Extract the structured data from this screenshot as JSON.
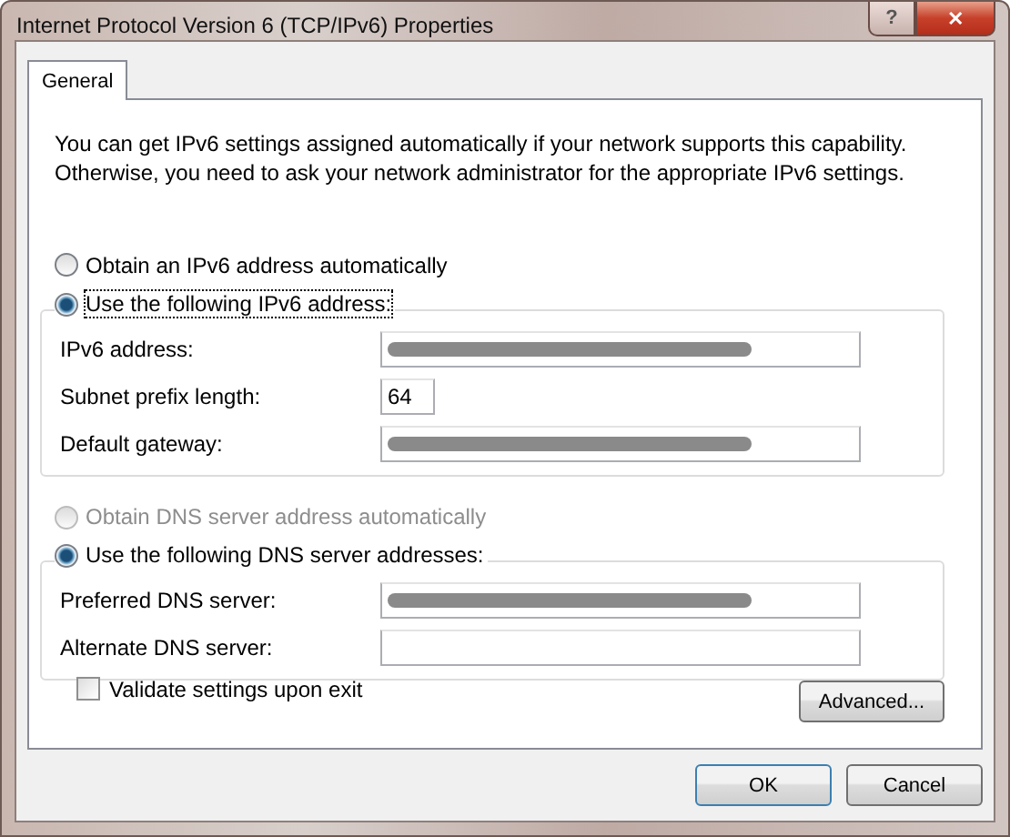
{
  "window": {
    "title": "Internet Protocol Version 6 (TCP/IPv6) Properties",
    "controls": [
      "?",
      "✕"
    ]
  },
  "tabs": [
    {
      "label": "General",
      "selected": true
    }
  ],
  "intro": "You can get IPv6 settings assigned automatically if your network supports this capability. Otherwise, you need to ask your network administrator for the appropriate IPv6 settings.",
  "address_options": [
    {
      "label": "Obtain an IPv6 address automatically",
      "selected": false,
      "disabled": false
    },
    {
      "label": "Use the following IPv6 address:",
      "selected": true,
      "disabled": false
    }
  ],
  "address_fields": [
    {
      "label": "IPv6 address:",
      "redacted": true,
      "kind": "address"
    },
    {
      "label": "Subnet prefix length:",
      "value": "64",
      "kind": "prefix"
    },
    {
      "label": "Default gateway:",
      "redacted": true,
      "kind": "address"
    }
  ],
  "dns_options": [
    {
      "label": "Obtain DNS server address automatically",
      "selected": false,
      "disabled": true
    },
    {
      "label": "Use the following DNS server addresses:",
      "selected": true,
      "disabled": false
    }
  ],
  "dns_fields": [
    {
      "label": "Preferred DNS server:",
      "redacted": true,
      "kind": "address"
    },
    {
      "label": "Alternate DNS server:",
      "kind": "address"
    }
  ],
  "validate": {
    "label": "Validate settings upon exit",
    "checked": false
  },
  "advanced_button": "Advanced...",
  "buttons": [
    {
      "label": "OK",
      "default": true
    },
    {
      "label": "Cancel",
      "default": false
    }
  ]
}
